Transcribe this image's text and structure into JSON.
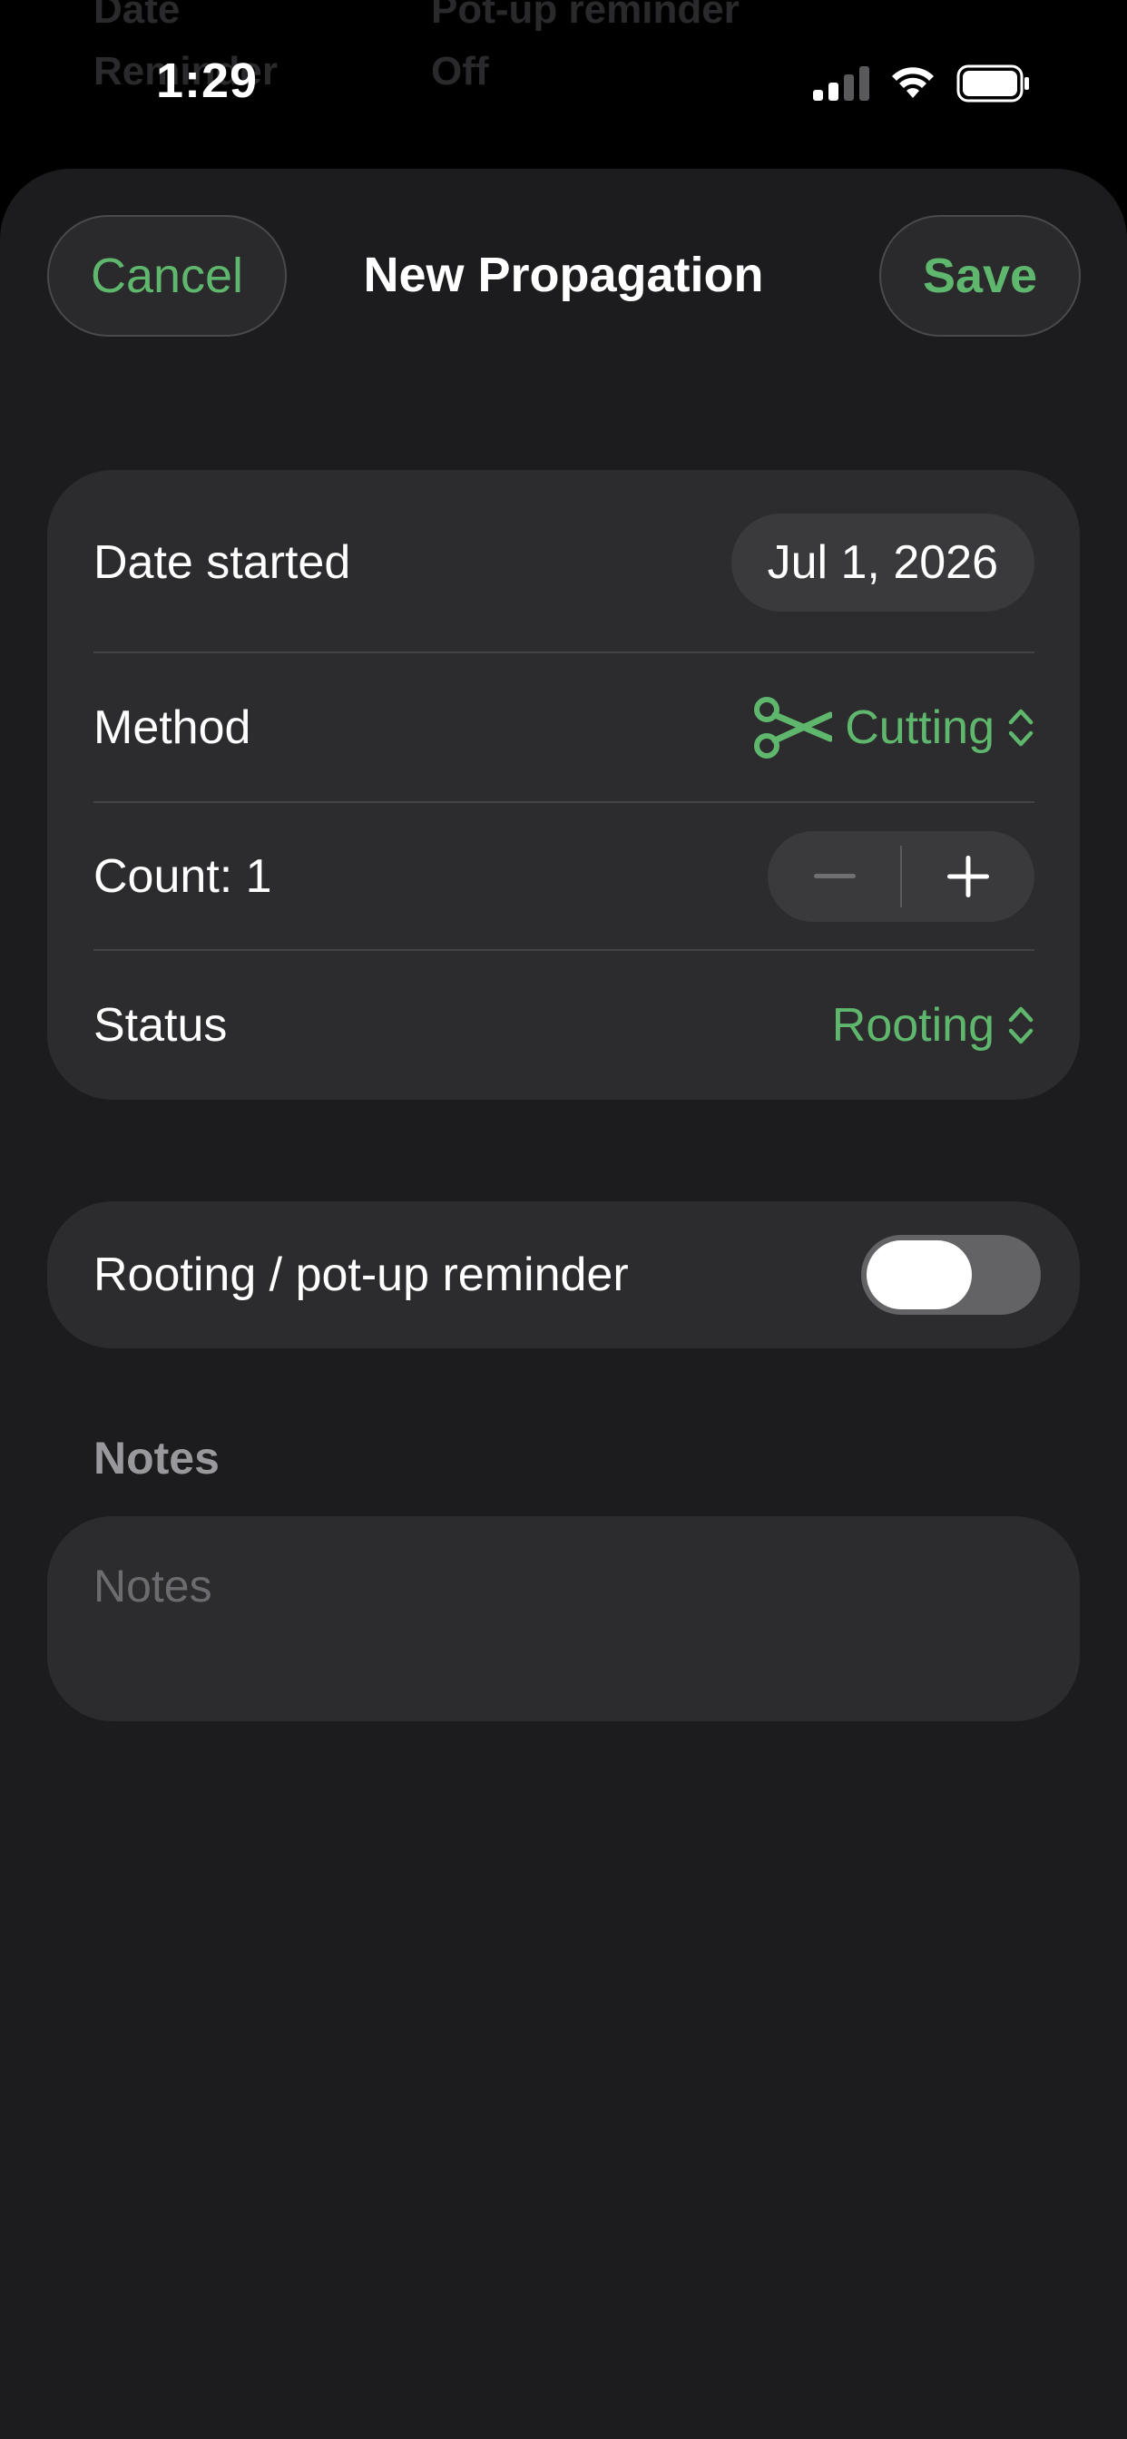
{
  "status_bar": {
    "time": "1:29",
    "icons": [
      "cellular-signal-icon",
      "wifi-icon",
      "battery-icon"
    ]
  },
  "background_page": {
    "row1_label": "Date",
    "row1_value": "Pot-up reminder",
    "row2_label": "Reminder",
    "row2_value": "Off"
  },
  "nav": {
    "cancel_label": "Cancel",
    "title": "New Propagation",
    "save_label": "Save"
  },
  "form": {
    "date_started": {
      "label": "Date started",
      "value": "Jul 1, 2026"
    },
    "method": {
      "label": "Method",
      "value": "Cutting",
      "icon": "scissors-icon"
    },
    "count": {
      "label": "Count: 1",
      "value": 1
    },
    "status": {
      "label": "Status",
      "value": "Rooting"
    }
  },
  "reminder": {
    "label": "Rooting / pot-up reminder",
    "enabled": false
  },
  "notes": {
    "header": "Notes",
    "placeholder": "Notes",
    "value": ""
  },
  "colors": {
    "accent": "#5fb76d",
    "background": "#1c1c1e",
    "card": "#2c2c2e",
    "secondary_text": "#98989d"
  }
}
